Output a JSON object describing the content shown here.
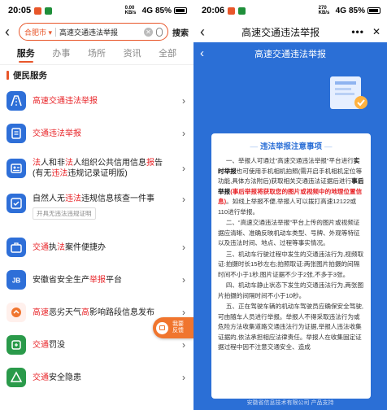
{
  "left": {
    "status": {
      "time": "20:05",
      "net": "0.00 KB/s",
      "signal": "4G",
      "battery": "85%"
    },
    "search": {
      "city": "合肥市",
      "query": "高速交通违法举报",
      "button": "搜索"
    },
    "tabs": [
      "服务",
      "办事",
      "场所",
      "资讯",
      "全部"
    ],
    "section": "便民服务",
    "items": [
      {
        "pre": "",
        "hl": "高速交通违法举报",
        "post": ""
      },
      {
        "pre": "",
        "hl": "交通违法举报",
        "post": ""
      },
      {
        "pre": "",
        "hl": "法",
        "post": "人和非",
        "hl2": "法",
        "post2": "人组织公共信用信息",
        "hl3": "报",
        "post3": "告(有无",
        "hl4": "违法",
        "post4": "违规记录证明版)"
      },
      {
        "pre": "自然人无",
        "hl": "违法",
        "post": "违规信息核查一件事",
        "tag": "开具无违法违规证明"
      },
      {
        "pre": "",
        "hl": "交通",
        "post": "执",
        "hl2": "法",
        "post2": "案件便捷办"
      },
      {
        "pre": "安徽省安全生产",
        "hl": "举报",
        "post": "平台"
      },
      {
        "pre": "",
        "hl": "高速",
        "post": "恶劣天气",
        "hl2": "高",
        "post2": "影响路段信息发布"
      },
      {
        "pre": "",
        "hl": "交通",
        "post": "罚没"
      },
      {
        "pre": "",
        "hl": "交通",
        "post": "安全隐患"
      }
    ],
    "float_button": "我要反馈"
  },
  "right": {
    "status": {
      "time": "20:06",
      "net": "270 KB/s",
      "signal": "4G",
      "battery": "85%"
    },
    "nav_title": "高速交通违法举报",
    "blue_title": "高速交通违法举报",
    "notice": {
      "title": "违法举报注意事项",
      "p1_a": "一、举报人可通过“高速交通违法举报”平台进行",
      "p1_b": "实时举报",
      "p1_c": "也可使用手机相机拍照(需开启手机相机定位等功能,具体方法附后)获取相关交通违法证据后进行",
      "p1_d": "事后举报",
      "p1_e": "(事后举报将获取您的图片或视频中的地理位置信息)",
      "p1_f": "。如线上举报不便,举报人可以拨打高速12122或110进行举报。",
      "p2": "二、“高速交通违法举报”平台上传的图片或视频证据应清晰、准确反映机动车类型、号牌、外观等特征以及违法时间、地点、过程等事实情况。",
      "p3": "三、机动车行驶过程中发生的交通违法行为,视频取证:拍摄时长15秒左右;拍照取证:两张图片拍摄的间隔时间不小于1秒,图片证据不少于2张,不多于3张。",
      "p4": "四、机动车静止状态下发生的交通违法行为,两张图片拍摄的间隔时间不小于10秒。",
      "p5": "五、正在驾驶车辆的机动车驾驶员应确保安全驾驶,可由随车人员进行举报。举报人不得采取违法行为或危险方法收集道路交通违法行为证据,举报人违法收集证据的,依法承担相应法律责任。举报人在收集固定证据过程中因不注意交通安全、造成"
    },
    "footer_ghost": "安徽省高速交通警察总队",
    "footer": "安徽省信息技术有限公司 产品支持"
  }
}
